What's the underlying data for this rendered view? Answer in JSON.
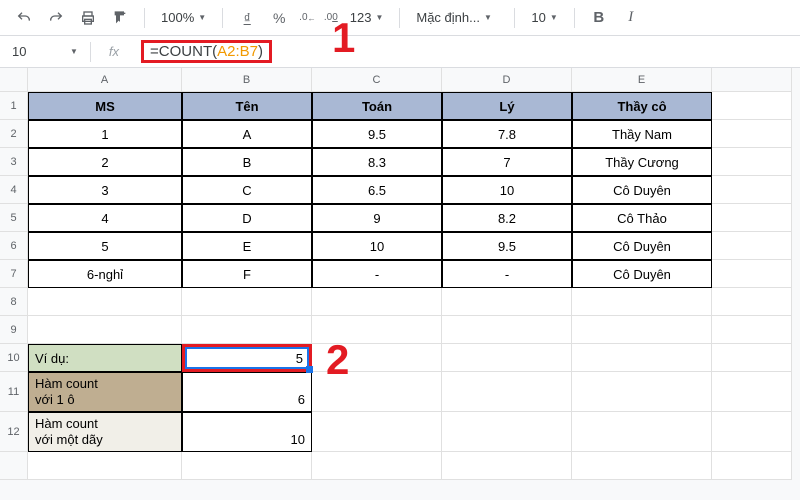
{
  "toolbar": {
    "zoom": "100%",
    "currency": "₫",
    "percent": "%",
    "decimals_dec": ".0←",
    "decimals_inc": ".00→",
    "numfmt": "123",
    "font": "Mặc định...",
    "size": "10",
    "bold": "B",
    "italic": "I"
  },
  "formula_bar": {
    "name_box": "10",
    "fx": "fx",
    "formula_prefix": "=COUNT(",
    "formula_range": "A2:B7",
    "formula_suffix": ")"
  },
  "columns": [
    "A",
    "B",
    "C",
    "D",
    "E"
  ],
  "headers": {
    "ms": "MS",
    "ten": "Tên",
    "toan": "Toán",
    "ly": "Lý",
    "thayco": "Thầy cô"
  },
  "rows": [
    {
      "r": "2",
      "ms": "1",
      "ten": "A",
      "toan": "9.5",
      "ly": "7.8",
      "thayco": "Thầy Nam"
    },
    {
      "r": "3",
      "ms": "2",
      "ten": "B",
      "toan": "8.3",
      "ly": "7",
      "thayco": "Thầy Cương"
    },
    {
      "r": "4",
      "ms": "3",
      "ten": "C",
      "toan": "6.5",
      "ly": "10",
      "thayco": "Cô Duyên"
    },
    {
      "r": "5",
      "ms": "4",
      "ten": "D",
      "toan": "9",
      "ly": "8.2",
      "thayco": "Cô Thảo"
    },
    {
      "r": "6",
      "ms": "5",
      "ten": "E",
      "toan": "10",
      "ly": "9.5",
      "thayco": "Cô Duyên"
    },
    {
      "r": "7",
      "ms": "6-nghỉ",
      "ten": "F",
      "toan": "-",
      "ly": "-",
      "thayco": "Cô Duyên"
    }
  ],
  "examples": {
    "vi_du": "Ví dụ:",
    "result1": "5",
    "ham1": "Hàm count\nvới 1 ô",
    "result2": "6",
    "ham2": "Hàm count\nvới một dãy",
    "result3": "10"
  },
  "annotations": {
    "one": "1",
    "two": "2"
  }
}
